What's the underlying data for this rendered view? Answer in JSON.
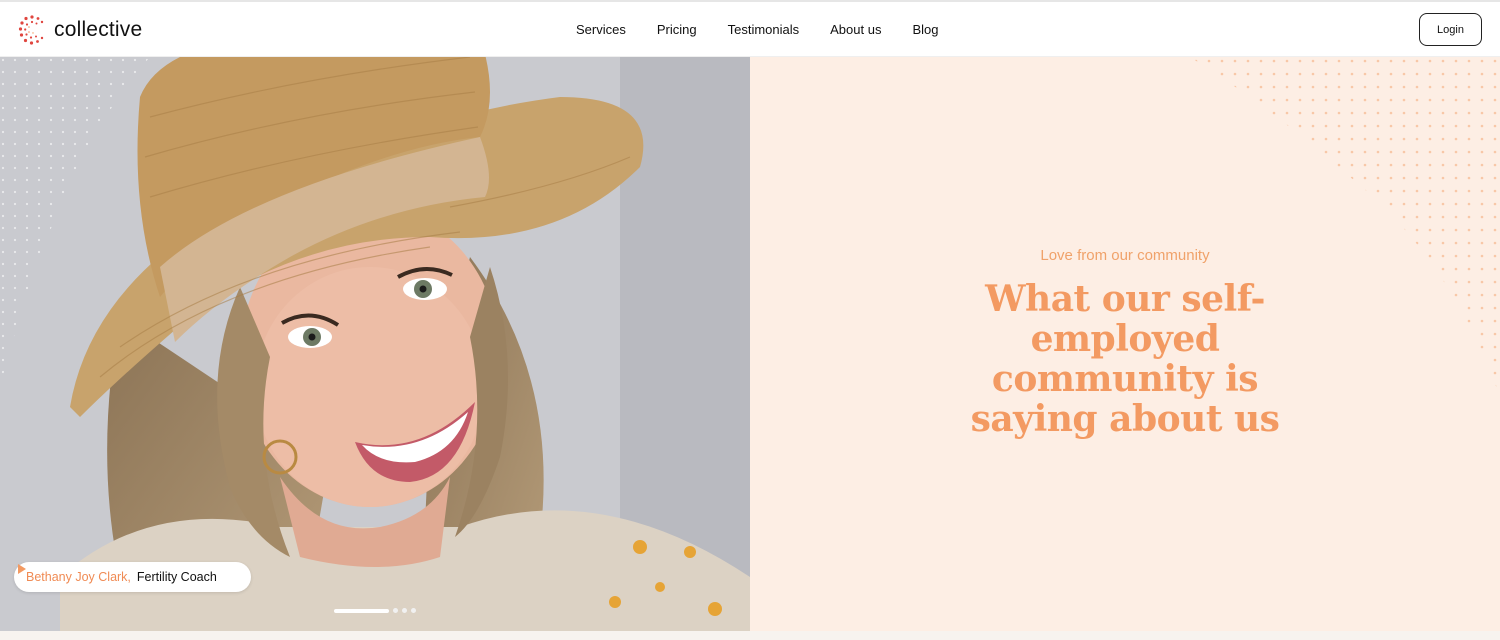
{
  "header": {
    "brand": "collective",
    "nav": [
      "Services",
      "Pricing",
      "Testimonials",
      "About us",
      "Blog"
    ],
    "login_label": "Login"
  },
  "hero": {
    "caption_name": "Bethany Joy Clark,",
    "caption_role": "Fertility Coach",
    "carousel_dots": 4,
    "active_dot": 1
  },
  "testimonials": {
    "eyebrow": "Love from our community",
    "headline_lines": [
      "What our self-",
      "employed",
      "community is",
      "saying about us"
    ]
  },
  "colors": {
    "accent": "#f39a62",
    "peach_bg": "#fdeee4",
    "logo_red": "#e0463f"
  }
}
